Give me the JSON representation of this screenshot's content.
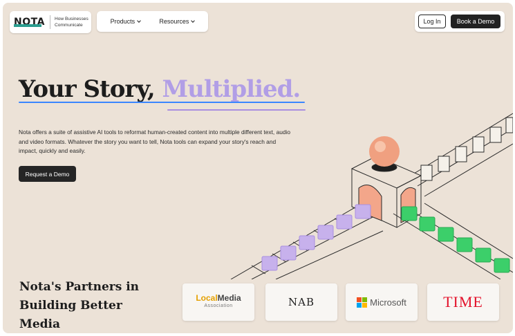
{
  "brand": {
    "logo_text": "NOTA",
    "tagline_line1": "How Businesses",
    "tagline_line2": "Communicate"
  },
  "nav": {
    "items": [
      {
        "label": "Products",
        "icon": "chevron-down-icon"
      },
      {
        "label": "Resources",
        "icon": "chevron-down-icon"
      }
    ],
    "login_label": "Log In",
    "book_demo_label": "Book a Demo"
  },
  "hero": {
    "title_part1": "Your Story,",
    "title_part2": "Multiplied.",
    "body": "Nota offers a suite of assistive AI tools to reformat human-created content into multiple different text, audio and video formats. Whatever the story you want to tell, Nota tools can expand your story's reach and impact, quickly and easily.",
    "cta_label": "Request a Demo"
  },
  "partners": {
    "title_line1": "Nota's Partners in",
    "title_line2": "Building Better",
    "title_line3": "Media",
    "logos": [
      {
        "name": "LocalMedia Association",
        "word1": "Local",
        "word2": "Media",
        "sub": "Association"
      },
      {
        "name": "NAB",
        "text": "NAB"
      },
      {
        "name": "Microsoft",
        "text": "Microsoft"
      },
      {
        "name": "TIME",
        "text": "TIME"
      }
    ]
  },
  "colors": {
    "background": "#ece2d7",
    "accent_purple": "#b19ee6",
    "underline_blue": "#3a86ff",
    "green_cube": "#3ccf6a",
    "purple_cube": "#c7b1ec",
    "ball": "#f0a080"
  }
}
